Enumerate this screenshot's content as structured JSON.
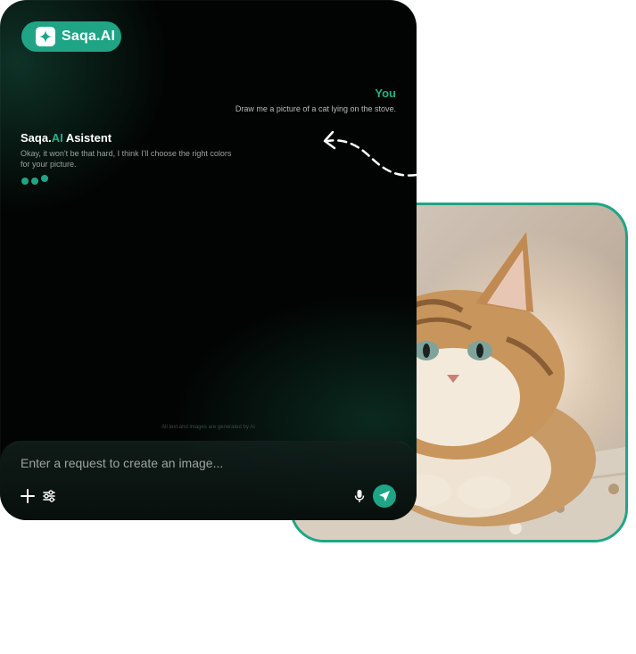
{
  "brand": {
    "name": "Saqa.AI",
    "accent": "#1fa586"
  },
  "chat": {
    "user": {
      "label": "You",
      "message": "Draw me a picture of a cat lying on the stove."
    },
    "assistant": {
      "title_prefix": "Saqa.",
      "title_ai": "AI",
      "title_suffix": " Asistent",
      "message": "Okay, it won't be that hard, I think I'll choose the right colors for your picture."
    },
    "typing_indicator": "three-dots"
  },
  "footnote": "All text and images are generated by AI",
  "composer": {
    "placeholder": "Enter a request to create an image...",
    "icons": [
      "plus-icon",
      "sliders-icon",
      "microphone-icon",
      "send-icon"
    ]
  },
  "generated_image": {
    "subject": "fluffy tabby kitten on a knitted blanket"
  }
}
